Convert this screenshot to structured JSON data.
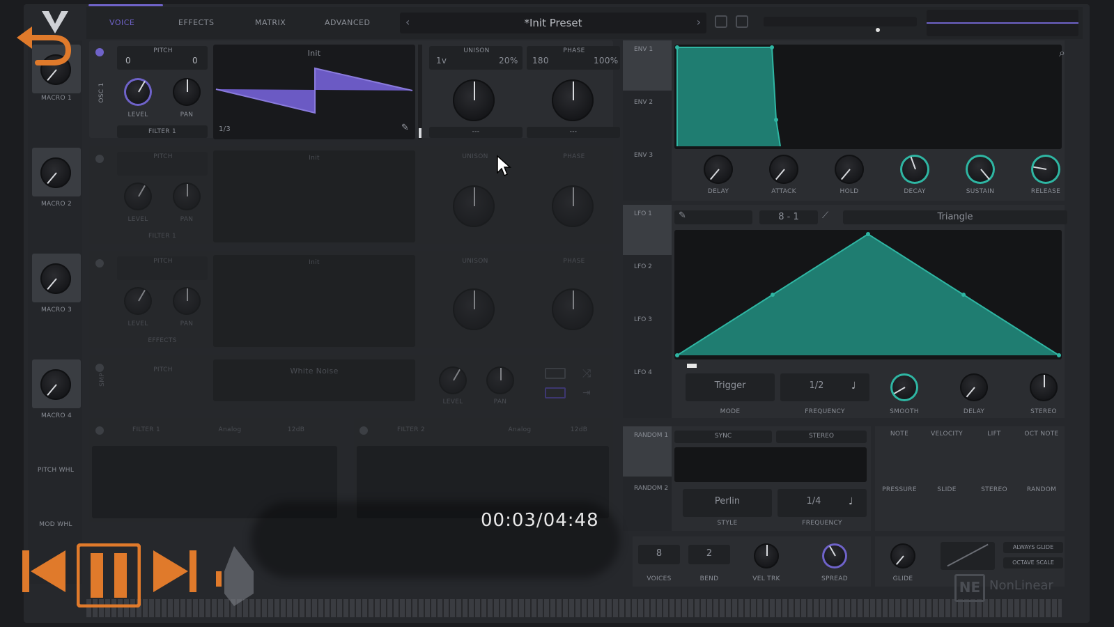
{
  "tabs": [
    {
      "label": "VOICE",
      "active": true
    },
    {
      "label": "EFFECTS"
    },
    {
      "label": "MATRIX"
    },
    {
      "label": "ADVANCED"
    }
  ],
  "preset": {
    "name": "*Init Preset"
  },
  "macros": [
    {
      "label": "MACRO 1"
    },
    {
      "label": "MACRO 2"
    },
    {
      "label": "MACRO 3"
    },
    {
      "label": "MACRO 4"
    }
  ],
  "wheels": {
    "pitch": "PITCH WHL",
    "mod": "MOD WHL"
  },
  "osc1": {
    "label": "OSC 1",
    "pitch_label": "PITCH",
    "pitch_left": "0",
    "pitch_right": "0",
    "level_label": "LEVEL",
    "pan_label": "PAN",
    "filter_label": "FILTER 1",
    "wave_name": "Init",
    "wave_frame": "1/3",
    "unison_label": "UNISON",
    "unison_voices": "1v",
    "unison_detune": "20%",
    "phase_label": "PHASE",
    "phase_value": "180",
    "phase_rand": "100%",
    "dash1": "---",
    "dash2": "---"
  },
  "osc_dim": {
    "pitch": "PITCH",
    "wave": "Init",
    "unison": "UNISON",
    "phase": "PHASE",
    "level": "LEVEL",
    "pan": "PAN",
    "filter1": "FILTER 1",
    "effects": "EFFECTS"
  },
  "smp": {
    "label": "SMP",
    "name": "White Noise",
    "pitch": "PITCH",
    "level": "LEVEL",
    "pan": "PAN"
  },
  "filters": [
    {
      "label": "FILTER 1",
      "model": "Analog",
      "type": "12dB"
    },
    {
      "label": "FILTER 2",
      "model": "Analog",
      "type": "12dB"
    }
  ],
  "env": {
    "tabs": [
      "ENV 1",
      "ENV 2",
      "ENV 3"
    ],
    "knobs": [
      "DELAY",
      "ATTACK",
      "HOLD",
      "DECAY",
      "SUSTAIN",
      "RELEASE"
    ]
  },
  "lfo": {
    "tabs": [
      "LFO 1",
      "LFO 2",
      "LFO 3",
      "LFO 4"
    ],
    "grid": "8 - 1",
    "shape": "Triangle",
    "mode_value": "Trigger",
    "mode_label": "MODE",
    "freq_value": "1/2",
    "freq_label": "FREQUENCY",
    "smooth_label": "SMOOTH",
    "delay_label": "DELAY",
    "stereo_label": "STEREO"
  },
  "random": {
    "tabs": [
      "RANDOM 1",
      "RANDOM 2"
    ],
    "sync": "SYNC",
    "stereo": "STEREO",
    "style_value": "Perlin",
    "style_label": "STYLE",
    "freq_value": "1/4",
    "freq_label": "FREQUENCY"
  },
  "mod_sources": [
    "NOTE",
    "VELOCITY",
    "LIFT",
    "OCT NOTE",
    "PRESSURE",
    "SLIDE",
    "STEREO",
    "RANDOM"
  ],
  "voice": {
    "voices_value": "8",
    "voices_label": "VOICES",
    "bend_value": "2",
    "bend_label": "BEND",
    "veltrk_label": "VEL TRK",
    "spread_label": "SPREAD",
    "glide_label": "GLIDE",
    "always_glide": "ALWAYS GLIDE",
    "octave_scale": "OCTAVE SCALE"
  },
  "player": {
    "time": "00:03/04:48"
  },
  "brand": {
    "logo_text": "NE",
    "name": "NonLinear"
  }
}
